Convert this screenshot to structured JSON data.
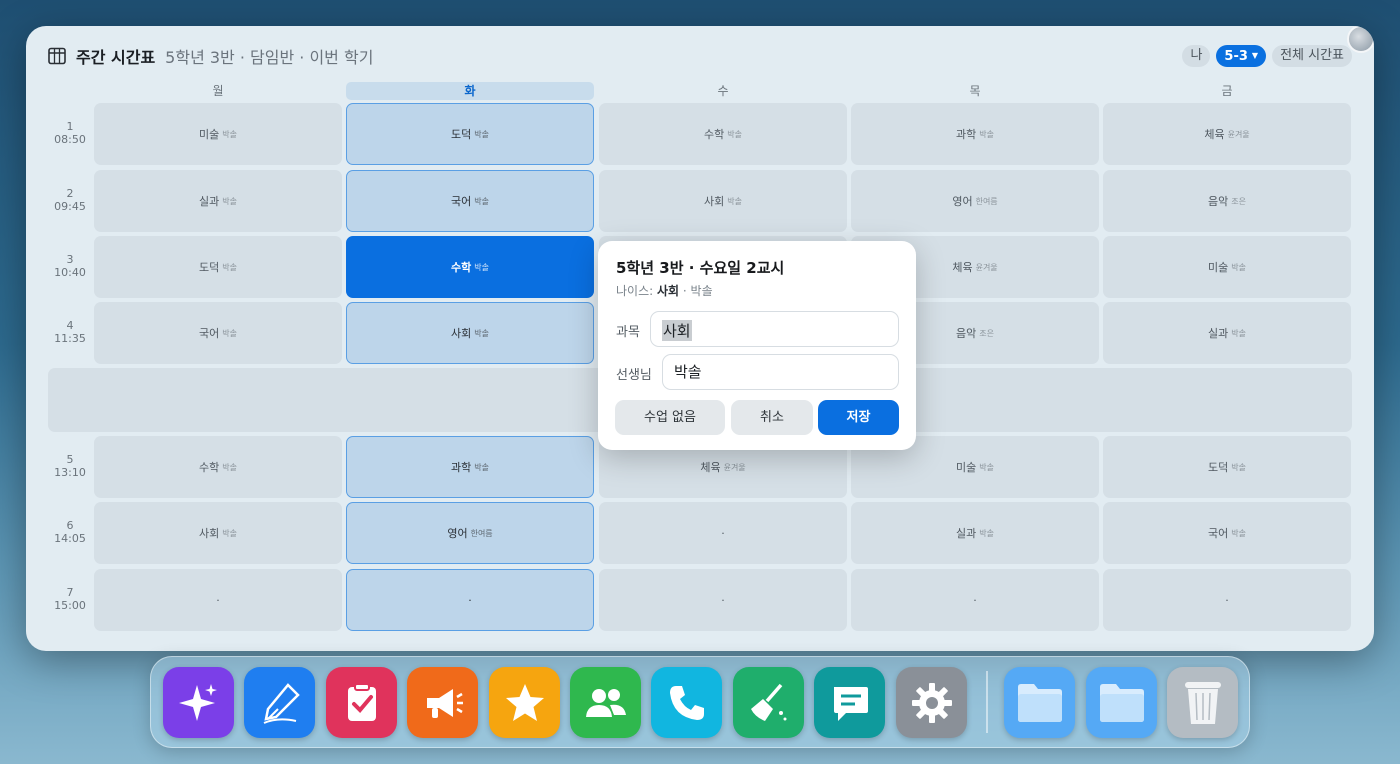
{
  "window": {
    "title": "주간 시간표",
    "subtitle": "5학년 3반 · 담임반 · 이번 학기",
    "view_tabs": [
      "나",
      "5-3",
      "전체 시간표"
    ],
    "active_tab": "5-3"
  },
  "days": [
    "월",
    "화",
    "수",
    "목",
    "금"
  ],
  "today": "화",
  "periods": [
    {
      "num": "1",
      "time": "08:50"
    },
    {
      "num": "2",
      "time": "09:45"
    },
    {
      "num": "3",
      "time": "10:40"
    },
    {
      "num": "4",
      "time": "11:35"
    },
    {
      "num": "5",
      "time": "13:10"
    },
    {
      "num": "6",
      "time": "14:05"
    },
    {
      "num": "7",
      "time": "15:00"
    }
  ],
  "grid": [
    [
      {
        "subject": "미술",
        "teacher": "박솔"
      },
      {
        "subject": "도덕",
        "teacher": "박솔"
      },
      {
        "subject": "수학",
        "teacher": "박솔"
      },
      {
        "subject": "과학",
        "teacher": "박솔"
      },
      {
        "subject": "체육",
        "teacher": "윤겨울"
      }
    ],
    [
      {
        "subject": "실과",
        "teacher": "박솔"
      },
      {
        "subject": "국어",
        "teacher": "박솔"
      },
      {
        "subject": "사회",
        "teacher": "박솔"
      },
      {
        "subject": "영어",
        "teacher": "한여름"
      },
      {
        "subject": "음악",
        "teacher": "조은"
      }
    ],
    [
      {
        "subject": "도덕",
        "teacher": "박솔"
      },
      {
        "subject": "수학",
        "teacher": "박솔"
      },
      {
        "subject": "",
        "teacher": ""
      },
      {
        "subject": "체육",
        "teacher": "윤겨울"
      },
      {
        "subject": "미술",
        "teacher": "박솔"
      }
    ],
    [
      {
        "subject": "국어",
        "teacher": "박솔"
      },
      {
        "subject": "사회",
        "teacher": "박솔"
      },
      {
        "subject": "",
        "teacher": ""
      },
      {
        "subject": "음악",
        "teacher": "조은"
      },
      {
        "subject": "실과",
        "teacher": "박솔"
      }
    ],
    [
      {
        "subject": "수학",
        "teacher": "박솔"
      },
      {
        "subject": "과학",
        "teacher": "박솔"
      },
      {
        "subject": "체육",
        "teacher": "윤겨울"
      },
      {
        "subject": "미술",
        "teacher": "박솔"
      },
      {
        "subject": "도덕",
        "teacher": "박솔"
      }
    ],
    [
      {
        "subject": "사회",
        "teacher": "박솔"
      },
      {
        "subject": "영어",
        "teacher": "한여름"
      },
      {
        "subject": "·",
        "teacher": ""
      },
      {
        "subject": "실과",
        "teacher": "박솔"
      },
      {
        "subject": "국어",
        "teacher": "박솔"
      }
    ],
    [
      {
        "subject": "·",
        "teacher": ""
      },
      {
        "subject": "·",
        "teacher": ""
      },
      {
        "subject": "·",
        "teacher": ""
      },
      {
        "subject": "·",
        "teacher": ""
      },
      {
        "subject": "·",
        "teacher": ""
      }
    ]
  ],
  "popup": {
    "title": "5학년 3반 · 수요일 2교시",
    "neis_prefix": "나이스:",
    "neis_subject": "사회",
    "neis_teacher": "· 박솔",
    "subject_label": "과목",
    "subject_value": "사회",
    "teacher_label": "선생님",
    "teacher_value": "박솔",
    "no_class_label": "수업 없음",
    "cancel_label": "취소",
    "save_label": "저장"
  },
  "dock": [
    {
      "name": "sparkle-icon",
      "color": "#7b3fe8"
    },
    {
      "name": "pen-icon",
      "color": "#1f7ef0"
    },
    {
      "name": "checklist-icon",
      "color": "#e0335c"
    },
    {
      "name": "megaphone-icon",
      "color": "#f06a1a"
    },
    {
      "name": "star-icon",
      "color": "#f6a50f"
    },
    {
      "name": "people-icon",
      "color": "#2fb84e"
    },
    {
      "name": "phone-icon",
      "color": "#11b6e0"
    },
    {
      "name": "broom-icon",
      "color": "#1fae6c"
    },
    {
      "name": "chat-icon",
      "color": "#0f9a9c"
    },
    {
      "name": "gear-icon",
      "color": "#8a9098"
    },
    {
      "name": "folder-icon",
      "color": "#55a9f5"
    },
    {
      "name": "folder-icon",
      "color": "#55a9f5"
    },
    {
      "name": "trash-icon",
      "color": "#b4bcc3"
    }
  ]
}
